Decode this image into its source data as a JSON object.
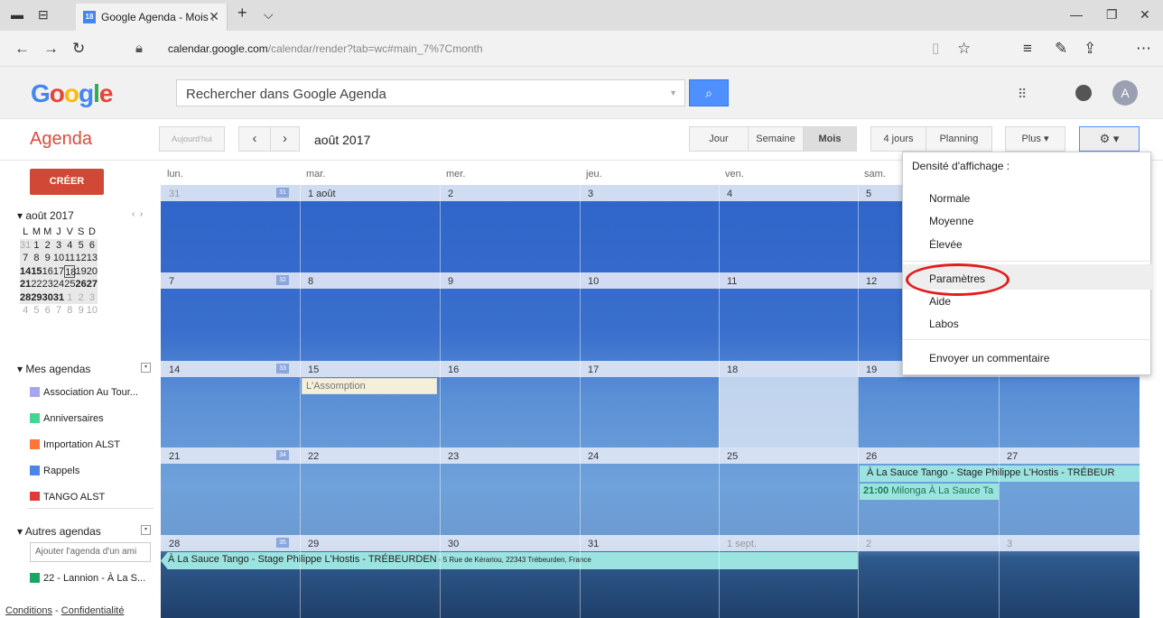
{
  "browser": {
    "tab_title": "Google Agenda - Mois :",
    "tab_favicon_text": "18",
    "url_host": "calendar.google.com",
    "url_path": "/calendar/render?tab=wc#main_7%7Cmonth"
  },
  "header": {
    "logo": "Google",
    "search_placeholder": "Rechercher dans Google Agenda",
    "avatar_letter": "A"
  },
  "toolbar": {
    "title": "Agenda",
    "today_label": "Aujourd'hui",
    "period": "août 2017",
    "views": [
      "Jour",
      "Semaine",
      "Mois",
      "4 jours",
      "Planning"
    ],
    "active_view": "Mois",
    "more_label": "Plus ▾"
  },
  "sidebar": {
    "create_label": "CRÉER",
    "mini_title": "août 2017",
    "mini_headers": [
      "L",
      "M",
      "M",
      "J",
      "V",
      "S",
      "D"
    ],
    "mini_weeks": [
      [
        "31",
        "1",
        "2",
        "3",
        "4",
        "5",
        "6"
      ],
      [
        "7",
        "8",
        "9",
        "10",
        "11",
        "12",
        "13"
      ],
      [
        "14",
        "15",
        "16",
        "17",
        "18",
        "19",
        "20"
      ],
      [
        "21",
        "22",
        "23",
        "24",
        "25",
        "26",
        "27"
      ],
      [
        "28",
        "29",
        "30",
        "31",
        "1",
        "2",
        "3"
      ],
      [
        "4",
        "5",
        "6",
        "7",
        "8",
        "9",
        "10"
      ]
    ],
    "my_calendars_title": "Mes agendas",
    "my_calendars": [
      {
        "label": "Association Au Tour...",
        "color": "#a4a4f0"
      },
      {
        "label": "Anniversaires",
        "color": "#42d692"
      },
      {
        "label": "Importation ALST",
        "color": "#ff7537"
      },
      {
        "label": "Rappels",
        "color": "#4986e7"
      },
      {
        "label": "TANGO ALST",
        "color": "#e03a3a"
      }
    ],
    "other_calendars_title": "Autres agendas",
    "add_friend_placeholder": "Ajouter l'agenda d'un ami",
    "other_calendars": [
      {
        "label": "22 - Lannion - À La S...",
        "color": "#16a765"
      }
    ],
    "footer_terms": "Conditions",
    "footer_sep": " - ",
    "footer_privacy": "Confidentialité"
  },
  "calendar": {
    "day_headers": [
      "lun.",
      "mar.",
      "mer.",
      "jeu.",
      "ven.",
      "sam."
    ],
    "weeks": [
      {
        "weeknum": "31",
        "days": [
          "31",
          "1 août",
          "2",
          "3",
          "4",
          "5",
          ""
        ]
      },
      {
        "weeknum": "32",
        "days": [
          "7",
          "8",
          "9",
          "10",
          "11",
          "12",
          ""
        ]
      },
      {
        "weeknum": "33",
        "days": [
          "14",
          "15",
          "16",
          "17",
          "18",
          "19",
          ""
        ]
      },
      {
        "weeknum": "34",
        "days": [
          "21",
          "22",
          "23",
          "24",
          "25",
          "26",
          "27"
        ]
      },
      {
        "weeknum": "35",
        "days": [
          "28",
          "29",
          "30",
          "31",
          "1 sept.",
          "2",
          "3"
        ]
      }
    ],
    "events": {
      "assumption": "L'Assomption",
      "stage_week4": "À La Sauce Tango - Stage Philippe L'Hostis - TRÉBEUR",
      "milonga_time": "21:00",
      "milonga_title": "Milonga À La Sauce Ta",
      "stage_week5": "À La Sauce Tango - Stage Philippe L'Hostis - TRÉBEURDEN",
      "stage_week5_location": " - 5 Rue de Kérariou, 22343 Trébeurden, France"
    }
  },
  "settings_menu": {
    "density_title": "Densité d'affichage :",
    "density_options": [
      "Normale",
      "Moyenne",
      "Élevée"
    ],
    "items": [
      "Paramètres",
      "Aide",
      "Labos"
    ],
    "feedback": "Envoyer un commentaire",
    "highlighted": "Paramètres"
  }
}
